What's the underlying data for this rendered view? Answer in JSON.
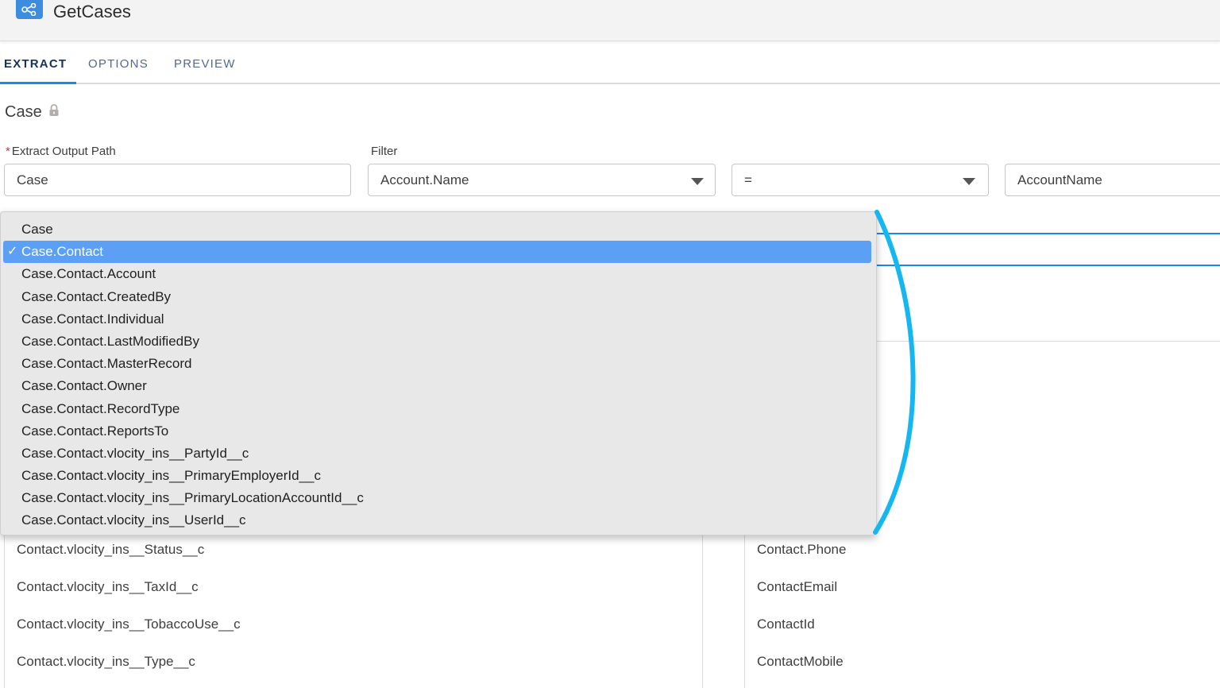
{
  "app": {
    "title": "GetCases",
    "icon": "hierarchy-icon",
    "accent_color": "#3c8ce0"
  },
  "tabs": [
    {
      "label": "EXTRACT",
      "active": true
    },
    {
      "label": "OPTIONS",
      "active": false
    },
    {
      "label": "PREVIEW",
      "active": false
    }
  ],
  "section": {
    "title": "Case",
    "icon": "lock-icon"
  },
  "fields": {
    "extract_output_path": {
      "label": "Extract Output Path",
      "required_mark": "*",
      "value": "Case"
    },
    "filter": {
      "label": "Filter",
      "field_value": "Account.Name",
      "operator_value": "=",
      "value": "AccountName"
    }
  },
  "dropdown": {
    "selected_index": 1,
    "check_mark": "✓",
    "selected_color": "#5ba0f5",
    "options": [
      "Case",
      "Case.Contact",
      "Case.Contact.Account",
      "Case.Contact.CreatedBy",
      "Case.Contact.Individual",
      "Case.Contact.LastModifiedBy",
      "Case.Contact.MasterRecord",
      "Case.Contact.Owner",
      "Case.Contact.RecordType",
      "Case.Contact.ReportsTo",
      "Case.Contact.vlocity_ins__PartyId__c",
      "Case.Contact.vlocity_ins__PrimaryEmployerId__c",
      "Case.Contact.vlocity_ins__PrimaryLocationAccountId__c",
      "Case.Contact.vlocity_ins__UserId__c"
    ]
  },
  "left_list": [
    "Contact.vlocity_ins__Status__c",
    "Contact.vlocity_ins__TaxId__c",
    "Contact.vlocity_ins__TobaccoUse__c",
    "Contact.vlocity_ins__Type__c"
  ],
  "right_list": [
    "Contact.Phone",
    "ContactEmail",
    "ContactId",
    "ContactMobile"
  ],
  "annotation_color": "#14b7ef"
}
